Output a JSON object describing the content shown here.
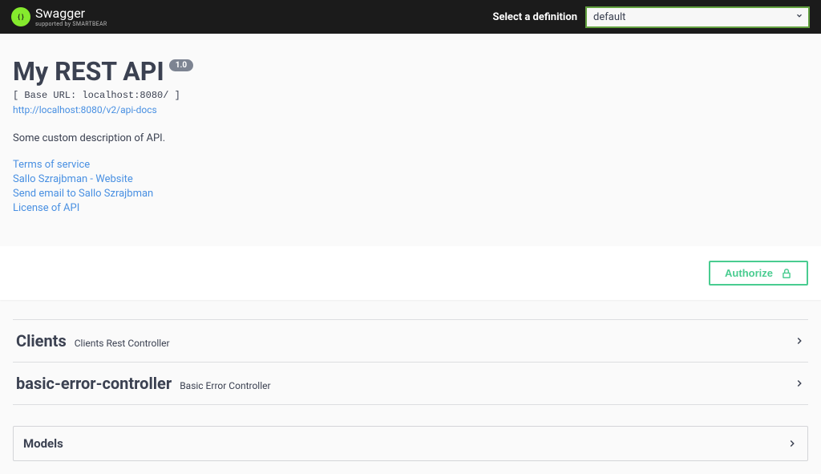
{
  "topbar": {
    "logo_main": "Swagger",
    "logo_sub": "supported by SMARTBEAR",
    "definition_label": "Select a definition",
    "definition_selected": "default"
  },
  "info": {
    "title": "My REST API",
    "version": "1.0",
    "base_url": "[ Base URL: localhost:8080/ ]",
    "docs_url": "http://localhost:8080/v2/api-docs",
    "description": "Some custom description of API.",
    "links": {
      "tos": "Terms of service",
      "contact_site": "Sallo Szrajbman - Website",
      "contact_email": "Send email to Sallo Szrajbman",
      "license": "License of API"
    }
  },
  "authorize_label": "Authorize",
  "tags": [
    {
      "name": "Clients",
      "description": "Clients Rest Controller"
    },
    {
      "name": "basic-error-controller",
      "description": "Basic Error Controller"
    }
  ],
  "models_label": "Models"
}
